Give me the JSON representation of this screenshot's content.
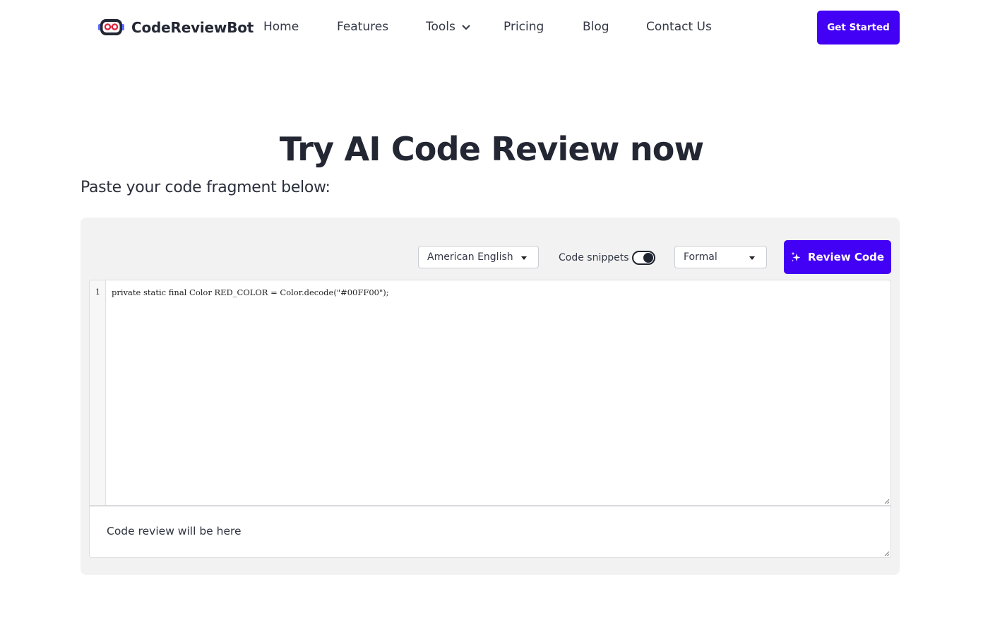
{
  "brand": {
    "name": "CodeReviewBot",
    "logo_icon": "robot-face-icon"
  },
  "nav": {
    "links": [
      {
        "label": "Home"
      },
      {
        "label": "Features"
      },
      {
        "label": "Tools",
        "dropdown": true
      },
      {
        "label": "Pricing"
      },
      {
        "label": "Blog"
      },
      {
        "label": "Contact Us"
      }
    ],
    "cta_label": "Get Started"
  },
  "hero": {
    "title": "Try AI Code Review now",
    "subtitle": "Paste your code fragment below:"
  },
  "toolbar": {
    "language_selected": "American English",
    "snippets_label": "Code snippets",
    "snippets_enabled": true,
    "tone_selected": "Formal",
    "review_label": "Review Code"
  },
  "editor": {
    "lines": [
      {
        "number": "1",
        "text": "private static final Color RED_COLOR = Color.decode(\"#00FF00\");"
      }
    ]
  },
  "output": {
    "placeholder": "Code review will be here"
  },
  "colors": {
    "accent": "#4200f5",
    "panel_bg": "#f2f2f2",
    "text": "#232733"
  }
}
